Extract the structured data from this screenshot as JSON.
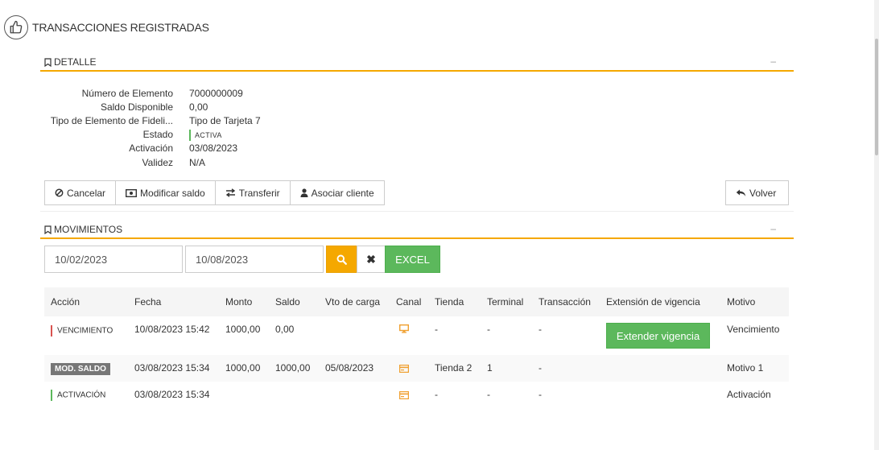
{
  "page": {
    "title": "TRANSACCIONES REGISTRADAS"
  },
  "detalle": {
    "title": "DETALLE",
    "collapse": "–",
    "rows": [
      {
        "label": "Número de Elemento",
        "value": "7000000009"
      },
      {
        "label": "Saldo Disponible",
        "value": "0,00"
      },
      {
        "label": "Tipo de Elemento de Fideli...",
        "value": "Tipo de Tarjeta 7"
      },
      {
        "label": "Estado",
        "value": "ACTIVA"
      },
      {
        "label": "Activación",
        "value": "03/08/2023"
      },
      {
        "label": "Validez",
        "value": "N/A"
      }
    ],
    "status_color": "#5cb85c"
  },
  "actions": {
    "cancelar": "Cancelar",
    "modificar_saldo": "Modificar saldo",
    "transferir": "Transferir",
    "asociar_cliente": "Asociar cliente",
    "volver": "Volver"
  },
  "movimientos": {
    "title": "MOVIMIENTOS",
    "collapse": "–",
    "date_from": "10/02/2023",
    "date_to": "10/08/2023",
    "excel_label": "EXCEL",
    "clear_label": "✖",
    "columns": [
      "Acción",
      "Fecha",
      "Monto",
      "Saldo",
      "Vto de carga",
      "Canal",
      "Tienda",
      "Terminal",
      "Transacción",
      "Extensión de vigencia",
      "Motivo"
    ],
    "rows": [
      {
        "accion": "VENCIMIENTO",
        "accion_color": "#d9534f",
        "fecha": "10/08/2023 15:42",
        "monto": "1000,00",
        "saldo": "0,00",
        "vto": "",
        "canal_icon": "monitor-icon",
        "tienda": "-",
        "terminal": "-",
        "transaccion": "-",
        "extension": "Extender vigencia",
        "motivo": "Vencimiento"
      },
      {
        "accion": "MOD. SALDO",
        "accion_color": "#777777",
        "fecha": "03/08/2023 15:34",
        "monto": "1000,00",
        "saldo": "1000,00",
        "vto": "05/08/2023",
        "canal_icon": "card-icon",
        "tienda": "Tienda 2",
        "terminal": "1",
        "transaccion": "-",
        "extension": "",
        "motivo": "Motivo 1"
      },
      {
        "accion": "ACTIVACIÓN",
        "accion_color": "#5cb85c",
        "fecha": "03/08/2023 15:34",
        "monto": "",
        "saldo": "",
        "vto": "",
        "canal_icon": "card-icon",
        "tienda": "-",
        "terminal": "-",
        "transaccion": "-",
        "extension": "",
        "motivo": "Activación"
      }
    ]
  },
  "colors": {
    "accent": "#f5a800",
    "success": "#5cb85c",
    "danger": "#d9534f",
    "icon_orange": "#f0a030"
  }
}
